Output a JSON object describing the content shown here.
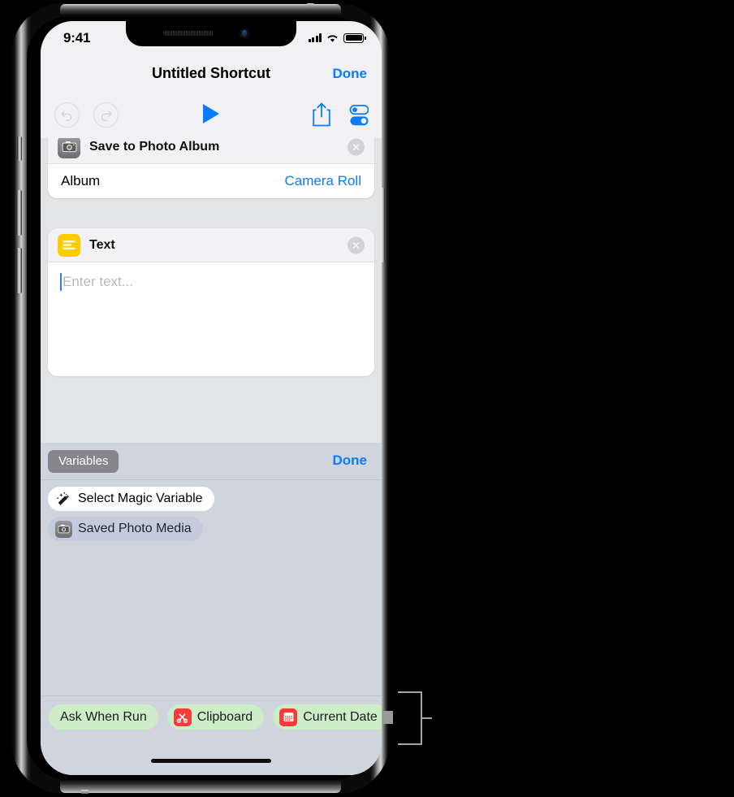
{
  "status_bar": {
    "time": "9:41",
    "signal_icon": "cellular-signal-icon",
    "wifi_icon": "wifi-icon",
    "battery_icon": "battery-full-icon"
  },
  "nav_bar": {
    "title": "Untitled Shortcut",
    "done_label": "Done"
  },
  "toolbar": {
    "undo_icon": "undo-arrow-icon",
    "redo_icon": "redo-arrow-icon",
    "play_icon": "play-triangle-icon",
    "share_icon": "share-icon",
    "settings_icon": "shortcut-settings-toggles-icon",
    "accent_color": "#0a7cff"
  },
  "actions": [
    {
      "title": "Save to Photo Album",
      "icon": "camera-icon",
      "icon_color": "#7e7e82",
      "close_icon": "close-circle-icon",
      "row_label": "Album",
      "row_value": "Camera Roll"
    },
    {
      "title": "Text",
      "icon": "text-lines-icon",
      "icon_color": "#ffcc00",
      "close_icon": "close-circle-icon",
      "placeholder": "Enter text..."
    }
  ],
  "variables_panel": {
    "tab_label": "Variables",
    "done_label": "Done",
    "items": [
      {
        "label": "Select Magic Variable",
        "icon": "magic-wand-icon",
        "style": "white"
      },
      {
        "label": "Saved Photo Media",
        "icon": "camera-icon",
        "style": "blue"
      }
    ]
  },
  "suggestion_bar": {
    "pills": [
      {
        "label": "Ask When Run",
        "icon": null
      },
      {
        "label": "Clipboard",
        "icon": "scissors-icon",
        "icon_color": "#f93b3b"
      },
      {
        "label": "Current Date",
        "icon": "calendar-icon",
        "icon_color": "#f93b3b"
      }
    ],
    "pill_color": "#cdedc9"
  },
  "annotation": {
    "bracket": "callout-bracket"
  }
}
